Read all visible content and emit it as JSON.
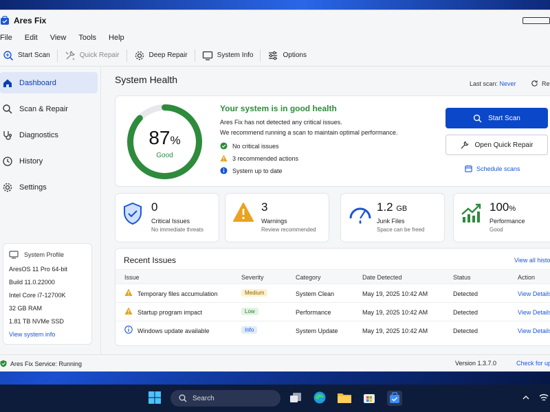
{
  "window": {
    "title": "Ares Fix"
  },
  "menu": [
    "File",
    "Edit",
    "View",
    "Tools",
    "Help"
  ],
  "toolbar": {
    "start_scan": "Start Scan",
    "quick_repair": "Quick Repair",
    "deep_repair": "Deep Repair",
    "system_info": "System Info",
    "options": "Options"
  },
  "sidebar": {
    "items": [
      {
        "label": "Dashboard",
        "icon": "home-icon"
      },
      {
        "label": "Scan & Repair",
        "icon": "search-icon"
      },
      {
        "label": "Diagnostics",
        "icon": "stethoscope-icon"
      },
      {
        "label": "History",
        "icon": "history-icon"
      },
      {
        "label": "Settings",
        "icon": "gear-icon"
      }
    ],
    "profile": {
      "title": "System Profile",
      "os": "AresOS 11 Pro 64-bit",
      "build": "Build 11.0.22000",
      "cpu": "Intel Core i7-12700K",
      "ram": "32 GB RAM",
      "disk": "1.81 TB NVMe SSD",
      "link": "View system info"
    }
  },
  "main": {
    "title": "System Health",
    "last_scan_label": "Last scan:",
    "last_scan_value": "Never",
    "refresh": "Ref",
    "health": {
      "score": "87",
      "score_unit": "%",
      "score_fraction": 0.87,
      "label": "Good",
      "headline": "Your system is in good health",
      "desc1": "Ares Fix has not detected any critical issues.",
      "desc2": "We recommend running a scan to maintain optimal performance.",
      "checks": [
        "No critical issues",
        "3 recommended actions",
        "System up to date"
      ],
      "start_scan": "Start Scan",
      "open_quick_repair": "Open Quick Repair",
      "schedule": "Schedule scans"
    },
    "stats": [
      {
        "value": "0",
        "unit": "",
        "label": "Critical Issues",
        "sub": "No immediate threats",
        "icon": "shield-check-icon"
      },
      {
        "value": "3",
        "unit": "",
        "label": "Warnings",
        "sub": "Review recommended",
        "icon": "warning-icon"
      },
      {
        "value": "1.2",
        "unit": "GB",
        "label": "Junk Files",
        "sub": "Space can be freed",
        "icon": "gauge-icon"
      },
      {
        "value": "100",
        "unit": "%",
        "label": "Performance",
        "sub": "Good",
        "icon": "trend-up-icon"
      }
    ],
    "issues": {
      "title": "Recent Issues",
      "view_all": "View all histo",
      "headers": [
        "Issue",
        "Severity",
        "Category",
        "Date Detected",
        "Status",
        "Action"
      ],
      "rows": [
        {
          "issue": "Temporary files accumulation",
          "severity": "Medium",
          "category": "System Clean",
          "date": "May 19, 2025 10:42 AM",
          "status": "Detected",
          "action": "View Details"
        },
        {
          "issue": "Startup program impact",
          "severity": "Low",
          "category": "Performance",
          "date": "May 19, 2025 10:42 AM",
          "status": "Detected",
          "action": "View Details"
        },
        {
          "issue": "Windows update available",
          "severity": "Info",
          "category": "System Update",
          "date": "May 19, 2025 10:42 AM",
          "status": "Detected",
          "action": "View Details"
        }
      ]
    }
  },
  "statusbar": {
    "service": "Ares Fix Service: Running",
    "version": "Version 1.3.7.0",
    "check_updates": "Check for up"
  },
  "taskbar": {
    "search": "Search"
  },
  "colors": {
    "accent": "#0b47c9",
    "good": "#2e8b3c",
    "warning": "#e3a21a",
    "info": "#1a56d6"
  }
}
